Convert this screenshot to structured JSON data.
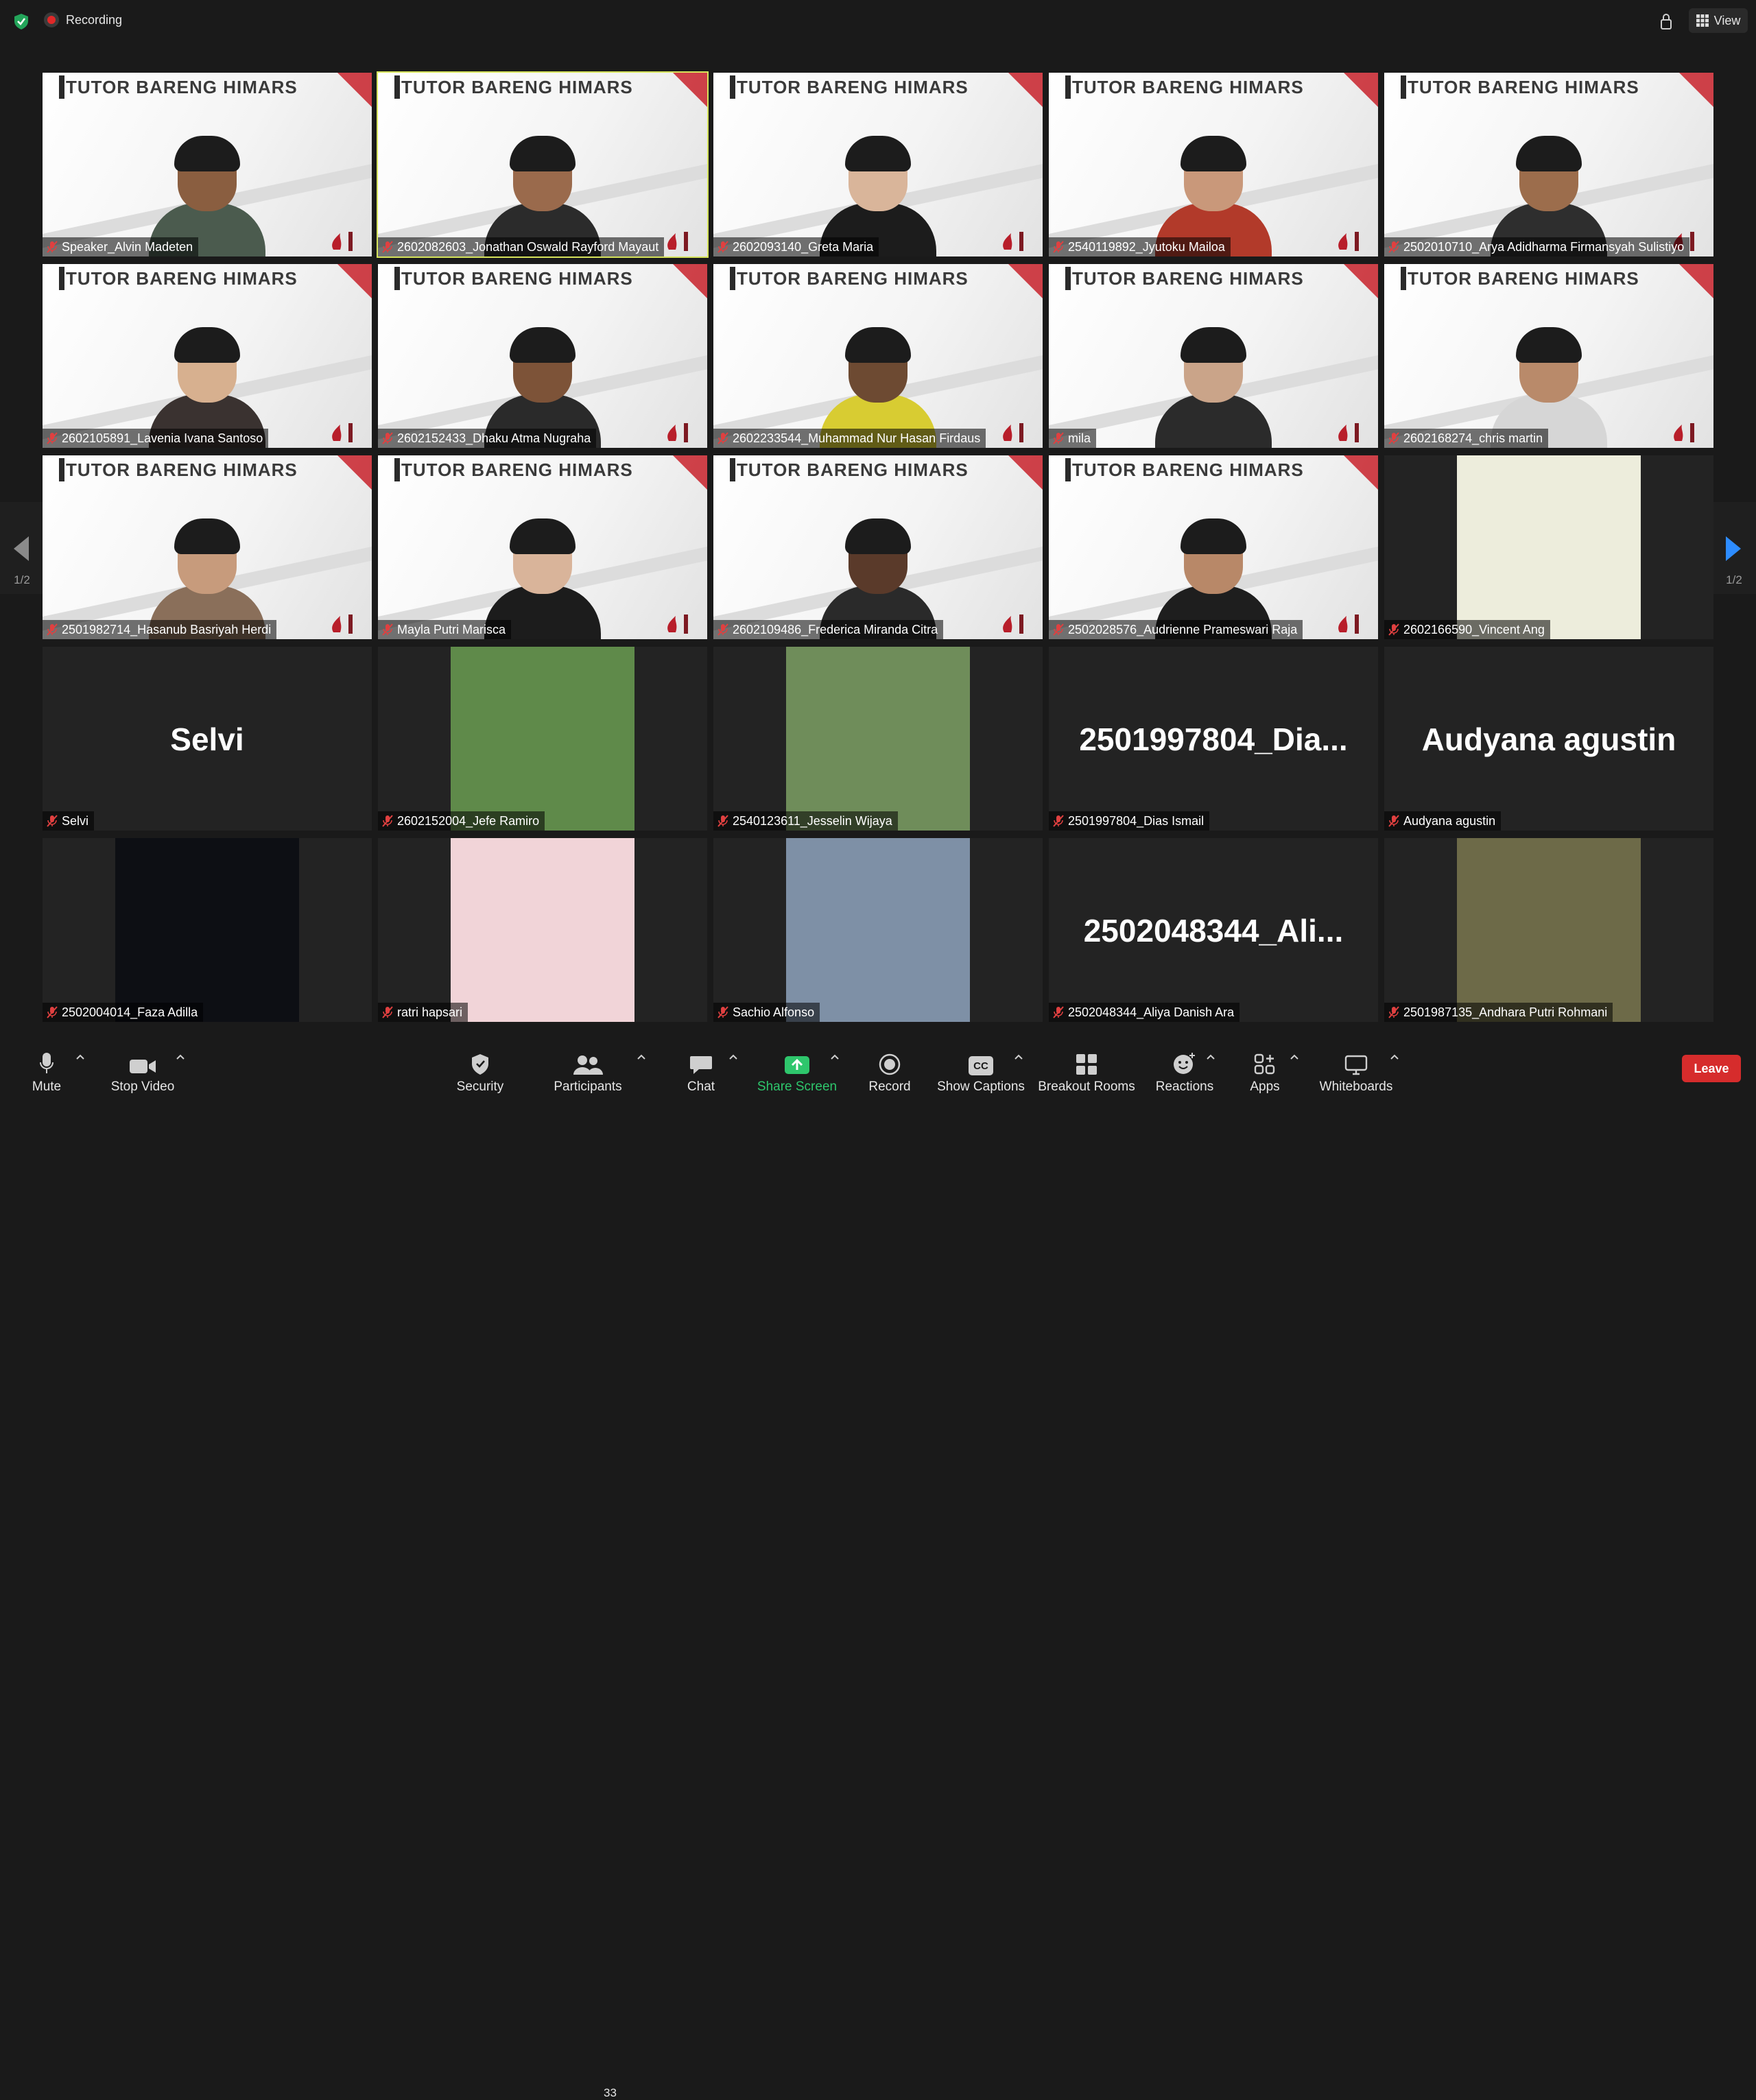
{
  "topbar": {
    "recording_label": "Recording",
    "view_label": "View"
  },
  "pagination": {
    "left": "1/2",
    "right": "1/2"
  },
  "banner_text": "TUTOR BARENG HIMARS",
  "tiles": [
    {
      "name": "Speaker_Alvin Madeten"
    },
    {
      "name": "2602082603_Jonathan Oswald Rayford Mayaut"
    },
    {
      "name": "2602093140_Greta Maria"
    },
    {
      "name": "2540119892_Jyutoku Mailoa"
    },
    {
      "name": "2502010710_Arya Adidharma Firmansyah Sulistiyo"
    },
    {
      "name": "2602105891_Lavenia Ivana Santoso"
    },
    {
      "name": "2602152433_Dhaku Atma Nugraha"
    },
    {
      "name": "2602233544_Muhammad Nur Hasan Firdaus"
    },
    {
      "name": "mila"
    },
    {
      "name": "2602168274_chris martin"
    },
    {
      "name": "2501982714_Hasanub Basriyah Herdi"
    },
    {
      "name": "Mayla Putri Marisca"
    },
    {
      "name": "2602109486_Frederica Miranda Citra"
    },
    {
      "name": "2502028576_Audrienne Prameswari Raja"
    },
    {
      "name": "2602166590_Vincent Ang"
    },
    {
      "name": "Selvi",
      "big": "Selvi"
    },
    {
      "name": "2602152004_Jefe Ramiro"
    },
    {
      "name": "2540123611_Jesselin Wijaya"
    },
    {
      "name": "2501997804_Dias Ismail",
      "big": "2501997804_Dia..."
    },
    {
      "name": "Audyana agustin",
      "big": "Audyana agustin"
    },
    {
      "name": "2502004014_Faza Adilla"
    },
    {
      "name": "ratri hapsari"
    },
    {
      "name": "Sachio Alfonso"
    },
    {
      "name": "2502048344_Aliya Danish Ara",
      "big": "2502048344_Ali..."
    },
    {
      "name": "2501987135_Andhara Putri Rohmani"
    }
  ],
  "toolbar": {
    "mute": "Mute",
    "stop_video": "Stop Video",
    "security": "Security",
    "participants": "Participants",
    "participants_count": "33",
    "chat": "Chat",
    "share_screen": "Share Screen",
    "record": "Record",
    "show_captions": "Show Captions",
    "breakout_rooms": "Breakout Rooms",
    "reactions": "Reactions",
    "apps": "Apps",
    "whiteboards": "Whiteboards",
    "leave": "Leave",
    "captions_icon": "CC"
  },
  "colors": {
    "active_speaker": "#d5e35a",
    "share_green": "#2ec66c",
    "leave_red": "#d62c2c",
    "recording_red": "#e02828"
  }
}
